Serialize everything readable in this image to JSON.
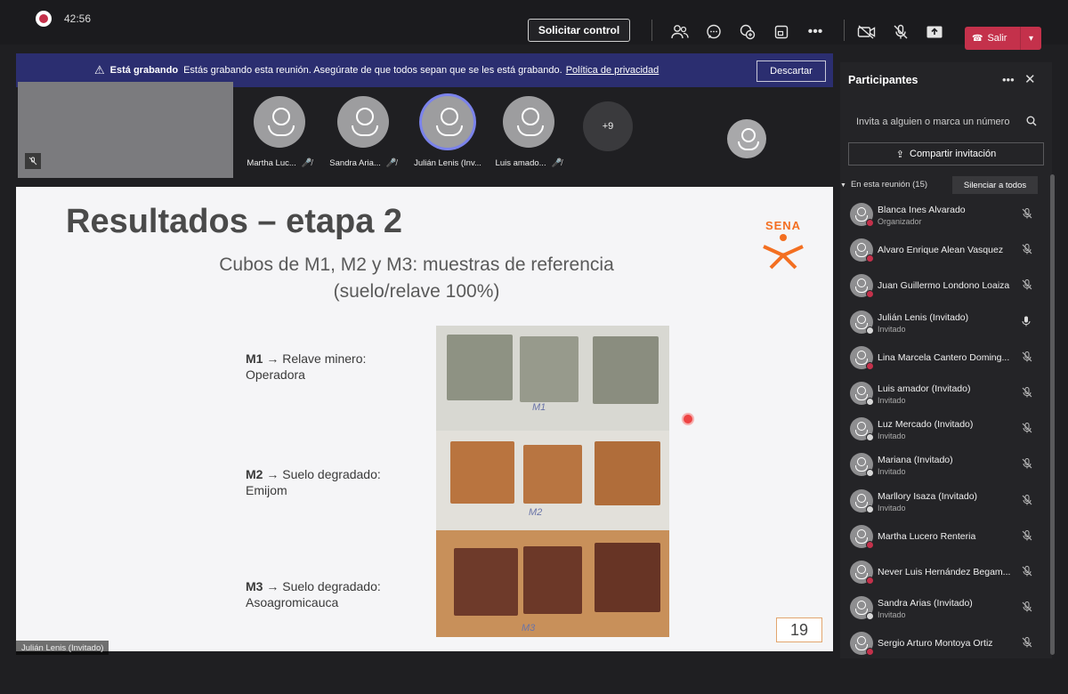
{
  "topbar": {
    "timer": "42:56",
    "request_control": "Solicitar control",
    "leave_label": "Salir"
  },
  "banner": {
    "title": "Está grabando",
    "message": "Estás grabando esta reunión. Asegúrate de que todos sepan que se les está grabando.",
    "link": "Política de privacidad",
    "discard": "Descartar"
  },
  "gallery": {
    "tiles": [
      {
        "name": "Martha Luc..."
      },
      {
        "name": "Sandra Aria..."
      },
      {
        "name": "Julián Lenis (Inv..."
      },
      {
        "name": "Luis amado..."
      }
    ],
    "more_count": "+9"
  },
  "slide": {
    "title": "Resultados – etapa 2",
    "subtitle_line1": "Cubos de M1, M2 y M3: muestras de referencia",
    "subtitle_line2": "(suelo/relave 100%)",
    "items": [
      {
        "code": "M1",
        "text": "→ Relave minero: Operadora"
      },
      {
        "code": "M2",
        "text": "→ Suelo degradado: Emijom"
      },
      {
        "code": "M3",
        "text": "→ Suelo degradado: Asoagromicauca"
      }
    ],
    "photo_labels": [
      "M1",
      "M2",
      "M3"
    ],
    "logo_text": "SENA",
    "page_number": "19",
    "presenter": "Julián Lenis (Invitado)",
    "colors": {
      "m1": "#8e9283",
      "m2": "#b9743f",
      "m3": "#6e3a2a",
      "sena": "#f36f21"
    }
  },
  "panel": {
    "title": "Participantes",
    "invite_placeholder": "Invita a alguien o marca un número",
    "share_invite": "Compartir invitación",
    "in_meeting": "En esta reunión (15)",
    "mute_all": "Silenciar a todos",
    "participants": [
      {
        "name": "Blanca Ines Alvarado",
        "role": "Organizador",
        "status": "busy",
        "mic": "muted"
      },
      {
        "name": "Alvaro Enrique Alean Vasquez",
        "role": "",
        "status": "busy",
        "mic": "muted"
      },
      {
        "name": "Juan Guillermo Londono Loaiza",
        "role": "",
        "status": "busy",
        "mic": "muted"
      },
      {
        "name": "Julián Lenis (Invitado)",
        "role": "Invitado",
        "status": "off",
        "mic": "on"
      },
      {
        "name": "Lina Marcela Cantero Doming...",
        "role": "",
        "status": "busy",
        "mic": "muted"
      },
      {
        "name": "Luis amador (Invitado)",
        "role": "Invitado",
        "status": "off",
        "mic": "muted"
      },
      {
        "name": "Luz Mercado (Invitado)",
        "role": "Invitado",
        "status": "off",
        "mic": "muted"
      },
      {
        "name": "Mariana (Invitado)",
        "role": "Invitado",
        "status": "off",
        "mic": "muted"
      },
      {
        "name": "Marllory Isaza (Invitado)",
        "role": "Invitado",
        "status": "off",
        "mic": "muted"
      },
      {
        "name": "Martha Lucero Renteria",
        "role": "",
        "status": "busy",
        "mic": "muted"
      },
      {
        "name": "Never Luis Hernández Begam...",
        "role": "",
        "status": "busy",
        "mic": "muted"
      },
      {
        "name": "Sandra Arias (Invitado)",
        "role": "Invitado",
        "status": "off",
        "mic": "muted"
      },
      {
        "name": "Sergio Arturo Montoya Ortiz",
        "role": "",
        "status": "busy",
        "mic": "muted"
      }
    ]
  }
}
